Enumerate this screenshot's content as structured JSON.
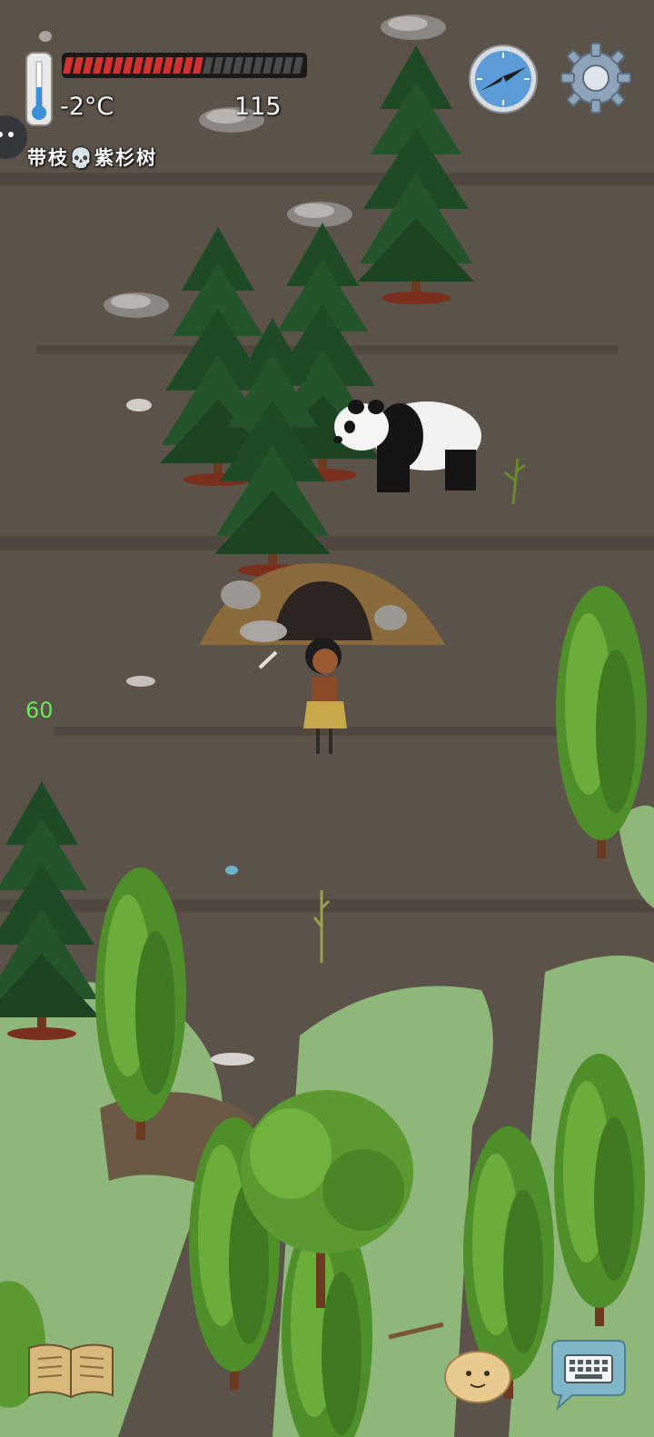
{
  "hud": {
    "temperature": "-2°C",
    "health_value": "115",
    "health_fraction": 0.58,
    "target_label": "带枝💀紫杉树",
    "fps": "60"
  },
  "icons": {
    "thermometer": "thermometer-icon",
    "compass": "compass-icon",
    "settings": "gear-icon",
    "journal": "book-icon",
    "emote": "potato-face-icon",
    "chat": "keyboard-chat-icon"
  },
  "colors": {
    "health_fill": "#d33030",
    "health_empty": "#4a4a4a",
    "fps_text": "#6be85a",
    "compass_face": "#5a9bd8",
    "ground": "#5b524a",
    "grass": "#8fb77a"
  }
}
